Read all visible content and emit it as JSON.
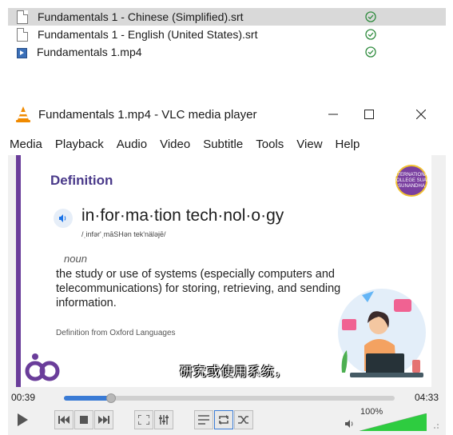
{
  "files": [
    {
      "name": "Fundamentals 1 - Chinese (Simplified).srt",
      "type": "doc",
      "selected": true
    },
    {
      "name": "Fundamentals 1 - English (United States).srt",
      "type": "doc",
      "selected": false
    },
    {
      "name": "Fundamentals 1.mp4",
      "type": "video",
      "selected": false
    }
  ],
  "vlc": {
    "title": "Fundamentals 1.mp4 - VLC media player",
    "menu": [
      "Media",
      "Playback",
      "Audio",
      "Video",
      "Subtitle",
      "Tools",
      "View",
      "Help"
    ],
    "video": {
      "heading": "Definition",
      "logo_text": "INTERNATIONAL COLLEGE SUAN SUNANDHA",
      "word": "in·for·ma·tion tech·nol·o·gy",
      "phonetic": "/ˌinfər'ˌmāSHən tek'näləjē/",
      "part_of_speech": "noun",
      "definition": "the study or use of systems (especially computers and telecommunications) for storing, retrieving, and sending information.",
      "source": "Definition from Oxford Languages",
      "subtitle": "研究或使用系统，"
    },
    "playback": {
      "elapsed": "00:39",
      "total": "04:33",
      "progress": 0.143
    },
    "volume": {
      "label": "100%",
      "level": 1.0
    }
  },
  "colors": {
    "accent": "#6a3d9a",
    "seek_fill": "#3a7bd5",
    "volume_green": "#2ecc40",
    "sync_green": "#2e8b3d"
  }
}
